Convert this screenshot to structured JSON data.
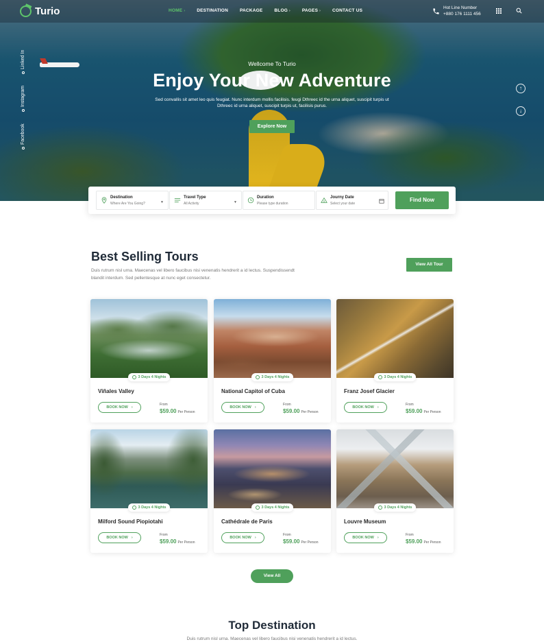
{
  "navbar": {
    "logo_text": "Turio",
    "items": [
      {
        "label": "HOME",
        "active": true,
        "caret": true
      },
      {
        "label": "DESTINATION",
        "active": false,
        "caret": false
      },
      {
        "label": "PACKAGE",
        "active": false,
        "caret": false
      },
      {
        "label": "BLOG",
        "active": false,
        "caret": true
      },
      {
        "label": "PAGES",
        "active": false,
        "caret": true
      },
      {
        "label": "CONTACT US",
        "active": false,
        "caret": false
      }
    ],
    "hotline_label": "Hot Line Number",
    "hotline_number": "+880 176 1111 456"
  },
  "social": [
    "Linked In",
    "Instagram",
    "Facebook"
  ],
  "hero": {
    "subtitle": "Wellcome To Turio",
    "title": "Enjoy Your New Adventure",
    "description": "Sed convallis sit amet leo quis feugiat. Nunc interdum mollis facilisis. feugi Dthreec id the urna aliquet, suscipit turpis ut Dthreec id urna aliquet, suscipit turpis ut, facilisis purus.",
    "button": "Explore Now"
  },
  "search": {
    "fields": [
      {
        "label": "Destination",
        "value": "Where Are You Going?",
        "icon": "map-pin-icon"
      },
      {
        "label": "Travel Type",
        "value": "All Activity",
        "icon": "list-icon"
      },
      {
        "label": "Duration",
        "value": "Please type duration",
        "icon": "clock-icon"
      },
      {
        "label": "Journy Date",
        "value": "Select your date",
        "icon": "calendar-icon"
      }
    ],
    "button": "Find Now"
  },
  "best_selling": {
    "title": "Best Selling Tours",
    "description": "Duis rutrum nisl urna. Maecenas vel libero faucibus nisi venenatis hendrerit a id lectus. Suspendissendt blandit interdum. Sed pellentesque at nunc eget consectetur.",
    "view_all_button": "View All Tour",
    "tours": [
      {
        "name": "Viñales Valley",
        "duration": "3 Days 4 Nights",
        "book": "BOOK NOW",
        "from": "From",
        "price": "$59.00",
        "per": "Per Person"
      },
      {
        "name": "National Capitol of Cuba",
        "duration": "3 Days 4 Nights",
        "book": "BOOK NOW",
        "from": "From",
        "price": "$59.00",
        "per": "Per Person"
      },
      {
        "name": "Franz Josef Glacier",
        "duration": "3 Days 4 Nights",
        "book": "BOOK NOW",
        "from": "From",
        "price": "$59.00",
        "per": "Per Person"
      },
      {
        "name": "Milford Sound Piopiotahi",
        "duration": "3 Days 4 Nights",
        "book": "BOOK NOW",
        "from": "From",
        "price": "$59.00",
        "per": "Per Person"
      },
      {
        "name": "Cathédrale de Paris",
        "duration": "3 Days 4 Nights",
        "book": "BOOK NOW",
        "from": "From",
        "price": "$59.00",
        "per": "Per Person"
      },
      {
        "name": "Louvre Museum",
        "duration": "3 Days 4 Nights",
        "book": "BOOK NOW",
        "from": "From",
        "price": "$59.00",
        "per": "Per Person"
      }
    ],
    "view_all": "View All"
  },
  "top_destination": {
    "title": "Top Destination",
    "description": "Duis rutrum nisl urna. Maecenas vel libero faucibus nisi venenatis hendrerit a id lectus."
  },
  "colors": {
    "accent": "#4fa05b",
    "dark": "#1f2a37"
  }
}
